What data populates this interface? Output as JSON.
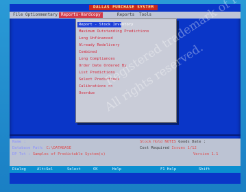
{
  "app": {
    "title": "DALLAS PURCHASE SYSTEM"
  },
  "menubar": {
    "items": [
      {
        "label": "File"
      },
      {
        "label": "Optionmentary"
      },
      {
        "label": "Reports-Hardcopy"
      },
      {
        "label": "Reports"
      },
      {
        "label": "Tools"
      }
    ]
  },
  "dropdown": {
    "items": [
      {
        "label": "Report - Stock Inventory"
      },
      {
        "label": "Maximum Outstanding Predictions"
      },
      {
        "label": "Long Unfinanced"
      },
      {
        "label": "Already Redelivery"
      },
      {
        "label": "Combined"
      },
      {
        "label": "Long Compliances"
      },
      {
        "label": "Order Date Ordered By"
      },
      {
        "label": "List Predictions"
      },
      {
        "label": "Select Predictions"
      },
      {
        "label": "Calibrations    >>"
      },
      {
        "label": "Overdue"
      }
    ]
  },
  "status": {
    "line1_label": "Name :",
    "line2_label": "Database Path:",
    "line2_value": "C:\\DATABASE",
    "line3_label": "DP Tot :",
    "line3_value": "Samples of Predictable System(s)",
    "right1_label": "Stock Hold NOTES",
    "right1_value": "Goods Date :",
    "right2_label": "Cost Required",
    "right2_value": "Issues 1/12",
    "right3_value": "Version 1.1"
  },
  "keybar": {
    "keys": [
      "Dialog",
      "Alt+Sel",
      "Select",
      "OK",
      "Help",
      "F1 Help",
      "Shift"
    ]
  },
  "watermark": {
    "line1": "Registered trademark of Pro",
    "line2": "All rights reserved."
  }
}
